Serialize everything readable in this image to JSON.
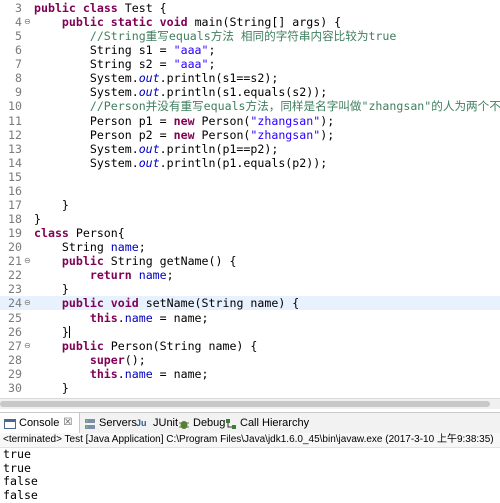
{
  "editor": {
    "lines": [
      {
        "n": "3",
        "fold": "",
        "segments": [
          {
            "t": "public",
            "c": "kw"
          },
          {
            "t": " "
          },
          {
            "t": "class",
            "c": "kw"
          },
          {
            "t": " Test {"
          }
        ]
      },
      {
        "n": "4",
        "fold": "⊖",
        "segments": [
          {
            "t": "    "
          },
          {
            "t": "public",
            "c": "kw"
          },
          {
            "t": " "
          },
          {
            "t": "static",
            "c": "kw"
          },
          {
            "t": " "
          },
          {
            "t": "void",
            "c": "kw"
          },
          {
            "t": " main(String[] args) {"
          }
        ]
      },
      {
        "n": "5",
        "fold": "",
        "segments": [
          {
            "t": "        "
          },
          {
            "t": "//String重写equals方法 相同的字符串内容比较为true",
            "c": "cm"
          }
        ]
      },
      {
        "n": "6",
        "fold": "",
        "segments": [
          {
            "t": "        String s1 = "
          },
          {
            "t": "\"aaa\"",
            "c": "str"
          },
          {
            "t": ";"
          }
        ]
      },
      {
        "n": "7",
        "fold": "",
        "segments": [
          {
            "t": "        String s2 = "
          },
          {
            "t": "\"aaa\"",
            "c": "str"
          },
          {
            "t": ";"
          }
        ]
      },
      {
        "n": "8",
        "fold": "",
        "segments": [
          {
            "t": "        System."
          },
          {
            "t": "out",
            "c": "fld it"
          },
          {
            "t": ".println(s1==s2);"
          }
        ]
      },
      {
        "n": "9",
        "fold": "",
        "segments": [
          {
            "t": "        System."
          },
          {
            "t": "out",
            "c": "fld it"
          },
          {
            "t": ".println(s1.equals(s2));"
          }
        ]
      },
      {
        "n": "10",
        "fold": "",
        "segments": [
          {
            "t": "        "
          },
          {
            "t": "//Person并没有重写equals方法，同样是名字叫做\"zhangsan\"的人为两个不同对象",
            "c": "cm"
          }
        ]
      },
      {
        "n": "11",
        "fold": "",
        "segments": [
          {
            "t": "        Person p1 = "
          },
          {
            "t": "new",
            "c": "kw"
          },
          {
            "t": " Person("
          },
          {
            "t": "\"zhangsan\"",
            "c": "str"
          },
          {
            "t": ");"
          }
        ]
      },
      {
        "n": "12",
        "fold": "",
        "segments": [
          {
            "t": "        Person p2 = "
          },
          {
            "t": "new",
            "c": "kw"
          },
          {
            "t": " Person("
          },
          {
            "t": "\"zhangsan\"",
            "c": "str"
          },
          {
            "t": ");"
          }
        ]
      },
      {
        "n": "13",
        "fold": "",
        "segments": [
          {
            "t": "        System."
          },
          {
            "t": "out",
            "c": "fld it"
          },
          {
            "t": ".println(p1==p2);"
          }
        ]
      },
      {
        "n": "14",
        "fold": "",
        "segments": [
          {
            "t": "        System."
          },
          {
            "t": "out",
            "c": "fld it"
          },
          {
            "t": ".println(p1.equals(p2));"
          }
        ]
      },
      {
        "n": "15",
        "fold": "",
        "segments": []
      },
      {
        "n": "16",
        "fold": "",
        "segments": []
      },
      {
        "n": "17",
        "fold": "",
        "segments": [
          {
            "t": "    }"
          }
        ]
      },
      {
        "n": "18",
        "fold": "",
        "segments": [
          {
            "t": "}"
          }
        ]
      },
      {
        "n": "19",
        "fold": "",
        "segments": [
          {
            "t": "class",
            "c": "kw"
          },
          {
            "t": " Person{"
          }
        ]
      },
      {
        "n": "20",
        "fold": "",
        "segments": [
          {
            "t": "    String "
          },
          {
            "t": "name",
            "c": "fld"
          },
          {
            "t": ";"
          }
        ]
      },
      {
        "n": "21",
        "fold": "⊖",
        "segments": [
          {
            "t": "    "
          },
          {
            "t": "public",
            "c": "kw"
          },
          {
            "t": " String getName() {"
          }
        ]
      },
      {
        "n": "22",
        "fold": "",
        "segments": [
          {
            "t": "        "
          },
          {
            "t": "return",
            "c": "kw"
          },
          {
            "t": " "
          },
          {
            "t": "name",
            "c": "fld"
          },
          {
            "t": ";"
          }
        ]
      },
      {
        "n": "23",
        "fold": "",
        "segments": [
          {
            "t": "    }"
          }
        ]
      },
      {
        "n": "24",
        "fold": "⊖",
        "segments": [
          {
            "t": "    "
          },
          {
            "t": "public",
            "c": "kw"
          },
          {
            "t": " "
          },
          {
            "t": "void",
            "c": "kw"
          },
          {
            "t": " setName(String name) {"
          }
        ],
        "current": true
      },
      {
        "n": "25",
        "fold": "",
        "segments": [
          {
            "t": "        "
          },
          {
            "t": "this",
            "c": "kw"
          },
          {
            "t": "."
          },
          {
            "t": "name",
            "c": "fld"
          },
          {
            "t": " = name;"
          }
        ]
      },
      {
        "n": "26",
        "fold": "",
        "segments": [
          {
            "t": "    }"
          }
        ],
        "cursor": true
      },
      {
        "n": "27",
        "fold": "⊖",
        "segments": [
          {
            "t": "    "
          },
          {
            "t": "public",
            "c": "kw"
          },
          {
            "t": " Person(String name) {"
          }
        ]
      },
      {
        "n": "28",
        "fold": "",
        "segments": [
          {
            "t": "        "
          },
          {
            "t": "super",
            "c": "kw"
          },
          {
            "t": "();"
          }
        ]
      },
      {
        "n": "29",
        "fold": "",
        "segments": [
          {
            "t": "        "
          },
          {
            "t": "this",
            "c": "kw"
          },
          {
            "t": "."
          },
          {
            "t": "name",
            "c": "fld"
          },
          {
            "t": " = name;"
          }
        ]
      },
      {
        "n": "30",
        "fold": "",
        "segments": [
          {
            "t": "    }"
          }
        ]
      }
    ]
  },
  "console": {
    "tabs": [
      {
        "label": "Console",
        "icon": "console-icon",
        "close": "☒",
        "active": true
      },
      {
        "label": "Servers",
        "icon": "servers-icon"
      },
      {
        "label": "JUnit",
        "icon": "junit-icon"
      },
      {
        "label": "Debug",
        "icon": "debug-icon"
      },
      {
        "label": "Call Hierarchy",
        "icon": "call-hierarchy-icon"
      }
    ],
    "status": "<terminated> Test [Java Application] C:\\Program Files\\Java\\jdk1.6.0_45\\bin\\javaw.exe (2017-3-10 上午9:38:35)",
    "output": [
      "true",
      "true",
      "false",
      "false"
    ]
  },
  "colors": {
    "keyword": "#7f0055",
    "string": "#2a00ff",
    "comment": "#3f7f5f",
    "field": "#0000c0",
    "line_highlight": "#e8f2fe"
  }
}
